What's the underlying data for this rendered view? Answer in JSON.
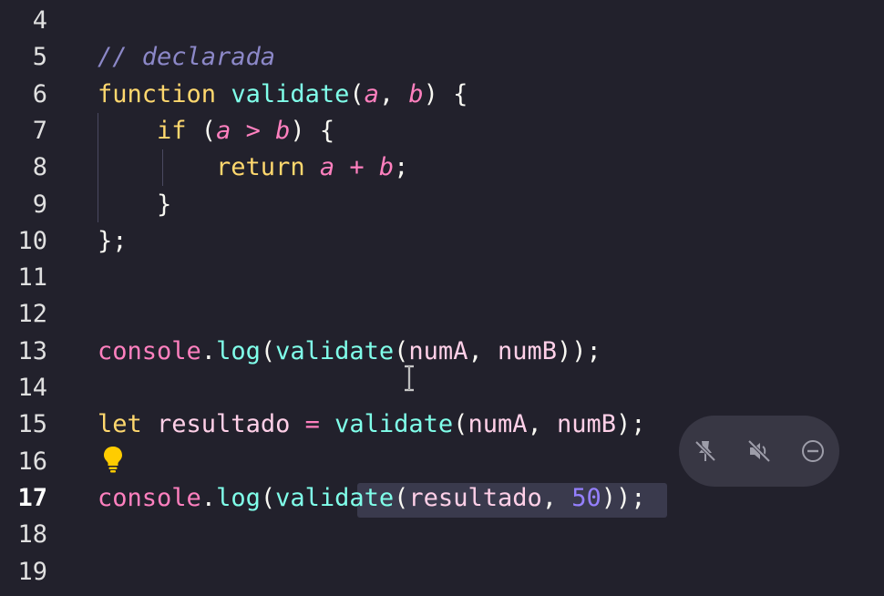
{
  "editor": {
    "active_line": "17",
    "lines": [
      {
        "num": "4",
        "tokens": []
      },
      {
        "num": "5",
        "tokens": [
          {
            "text": "// declarada",
            "cls": "c-comment"
          }
        ]
      },
      {
        "num": "6",
        "tokens": [
          {
            "text": "function ",
            "cls": "c-keyword"
          },
          {
            "text": "validate",
            "cls": "c-fn"
          },
          {
            "text": "(",
            "cls": "c-punct"
          },
          {
            "text": "a",
            "cls": "c-param"
          },
          {
            "text": ", ",
            "cls": "c-punct"
          },
          {
            "text": "b",
            "cls": "c-param"
          },
          {
            "text": ") {",
            "cls": "c-punct"
          }
        ]
      },
      {
        "num": "7",
        "tokens": [
          {
            "text": "    if ",
            "cls": "c-keyword"
          },
          {
            "text": "(",
            "cls": "c-punct"
          },
          {
            "text": "a",
            "cls": "c-param"
          },
          {
            "text": " > ",
            "cls": "c-obj"
          },
          {
            "text": "b",
            "cls": "c-param"
          },
          {
            "text": ") {",
            "cls": "c-punct"
          }
        ]
      },
      {
        "num": "8",
        "tokens": [
          {
            "text": "        return ",
            "cls": "c-keyword"
          },
          {
            "text": "a",
            "cls": "c-param"
          },
          {
            "text": " + ",
            "cls": "c-obj"
          },
          {
            "text": "b",
            "cls": "c-param"
          },
          {
            "text": ";",
            "cls": "c-punct"
          }
        ]
      },
      {
        "num": "9",
        "tokens": [
          {
            "text": "    }",
            "cls": "c-punct"
          }
        ]
      },
      {
        "num": "10",
        "tokens": [
          {
            "text": "};",
            "cls": "c-punct"
          }
        ]
      },
      {
        "num": "11",
        "tokens": []
      },
      {
        "num": "12",
        "tokens": []
      },
      {
        "num": "13",
        "tokens": [
          {
            "text": "console",
            "cls": "c-obj"
          },
          {
            "text": ".",
            "cls": "c-punct"
          },
          {
            "text": "log",
            "cls": "c-fn"
          },
          {
            "text": "(",
            "cls": "c-punct"
          },
          {
            "text": "validate",
            "cls": "c-fn"
          },
          {
            "text": "(",
            "cls": "c-punct"
          },
          {
            "text": "numA",
            "cls": "c-var"
          },
          {
            "text": ", ",
            "cls": "c-punct"
          },
          {
            "text": "numB",
            "cls": "c-var"
          },
          {
            "text": "));",
            "cls": "c-punct"
          }
        ]
      },
      {
        "num": "14",
        "tokens": []
      },
      {
        "num": "15",
        "tokens": [
          {
            "text": "let ",
            "cls": "c-keyword"
          },
          {
            "text": "resultado",
            "cls": "c-var"
          },
          {
            "text": " = ",
            "cls": "c-obj"
          },
          {
            "text": "validate",
            "cls": "c-fn"
          },
          {
            "text": "(",
            "cls": "c-punct"
          },
          {
            "text": "numA",
            "cls": "c-var"
          },
          {
            "text": ", ",
            "cls": "c-punct"
          },
          {
            "text": "numB",
            "cls": "c-var"
          },
          {
            "text": ");",
            "cls": "c-punct"
          }
        ]
      },
      {
        "num": "16",
        "tokens": []
      },
      {
        "num": "17",
        "tokens": [
          {
            "text": "console",
            "cls": "c-obj"
          },
          {
            "text": ".",
            "cls": "c-punct"
          },
          {
            "text": "log",
            "cls": "c-fn"
          },
          {
            "text": "(",
            "cls": "c-punct"
          },
          {
            "text": "validate",
            "cls": "c-fn"
          },
          {
            "text": "(",
            "cls": "c-punct"
          },
          {
            "text": "resultado",
            "cls": "c-var"
          },
          {
            "text": ", ",
            "cls": "c-punct"
          },
          {
            "text": "50",
            "cls": "c-num"
          },
          {
            "text": "));",
            "cls": "c-punct"
          }
        ]
      },
      {
        "num": "18",
        "tokens": []
      },
      {
        "num": "19",
        "tokens": []
      }
    ]
  },
  "icons": {
    "lightbulb": "lightbulb-icon",
    "text_cursor": "text-cursor-icon",
    "unpin": "pin-off-icon",
    "mute": "volume-off-icon",
    "close": "minus-circle-icon"
  },
  "colors": {
    "background": "#22212c",
    "comment": "#8c88c8",
    "keyword": "#ffd86e",
    "function": "#80ffea",
    "parameter": "#ff80bf",
    "number": "#9580ff",
    "lightbulb": "#ffcc00"
  }
}
